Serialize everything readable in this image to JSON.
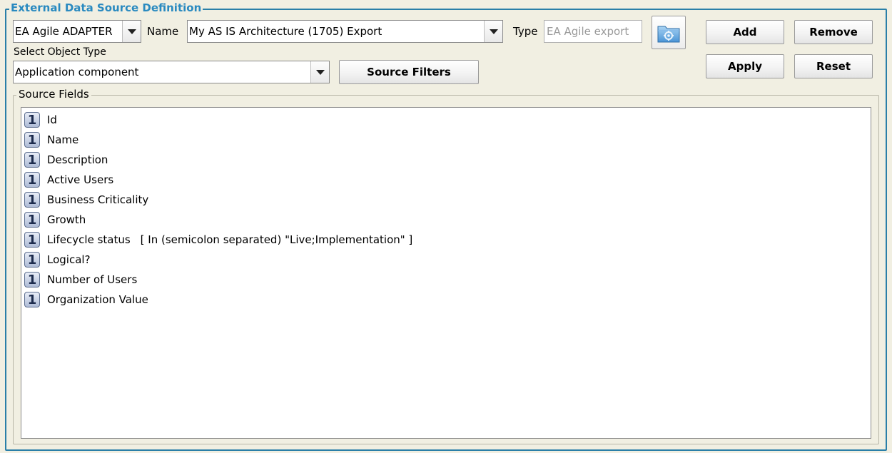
{
  "group": {
    "title": "External Data Source Definition"
  },
  "adapter_select": {
    "value": "EA Agile ADAPTER"
  },
  "name_field": {
    "label": "Name",
    "value": "My AS IS Architecture (1705) Export"
  },
  "type_field": {
    "label": "Type",
    "value": "EA Agile export"
  },
  "object_type": {
    "label": "Select Object Type",
    "value": "Application component"
  },
  "buttons": {
    "source_filters": "Source Filters",
    "add": "Add",
    "remove": "Remove",
    "apply": "Apply",
    "reset": "Reset"
  },
  "icons": {
    "settings_folder": "folder-gear-icon",
    "dropdown": "chevron-down-icon",
    "field_type": "single-value-badge-icon"
  },
  "source_fields": {
    "title": "Source Fields",
    "badge": "1",
    "items": [
      {
        "name": "Id",
        "filter": ""
      },
      {
        "name": "Name",
        "filter": ""
      },
      {
        "name": "Description",
        "filter": ""
      },
      {
        "name": "Active Users",
        "filter": ""
      },
      {
        "name": "Business Criticality",
        "filter": ""
      },
      {
        "name": "Growth",
        "filter": ""
      },
      {
        "name": "Lifecycle status",
        "filter": "[ In (semicolon separated) \"Live;Implementation\" ]"
      },
      {
        "name": "Logical?",
        "filter": ""
      },
      {
        "name": "Number of Users",
        "filter": ""
      },
      {
        "name": "Organization Value",
        "filter": ""
      }
    ]
  },
  "colors": {
    "accent": "#2a7fa8",
    "title_text": "#2a8ac0",
    "panel_bg": "#f1efe2"
  }
}
